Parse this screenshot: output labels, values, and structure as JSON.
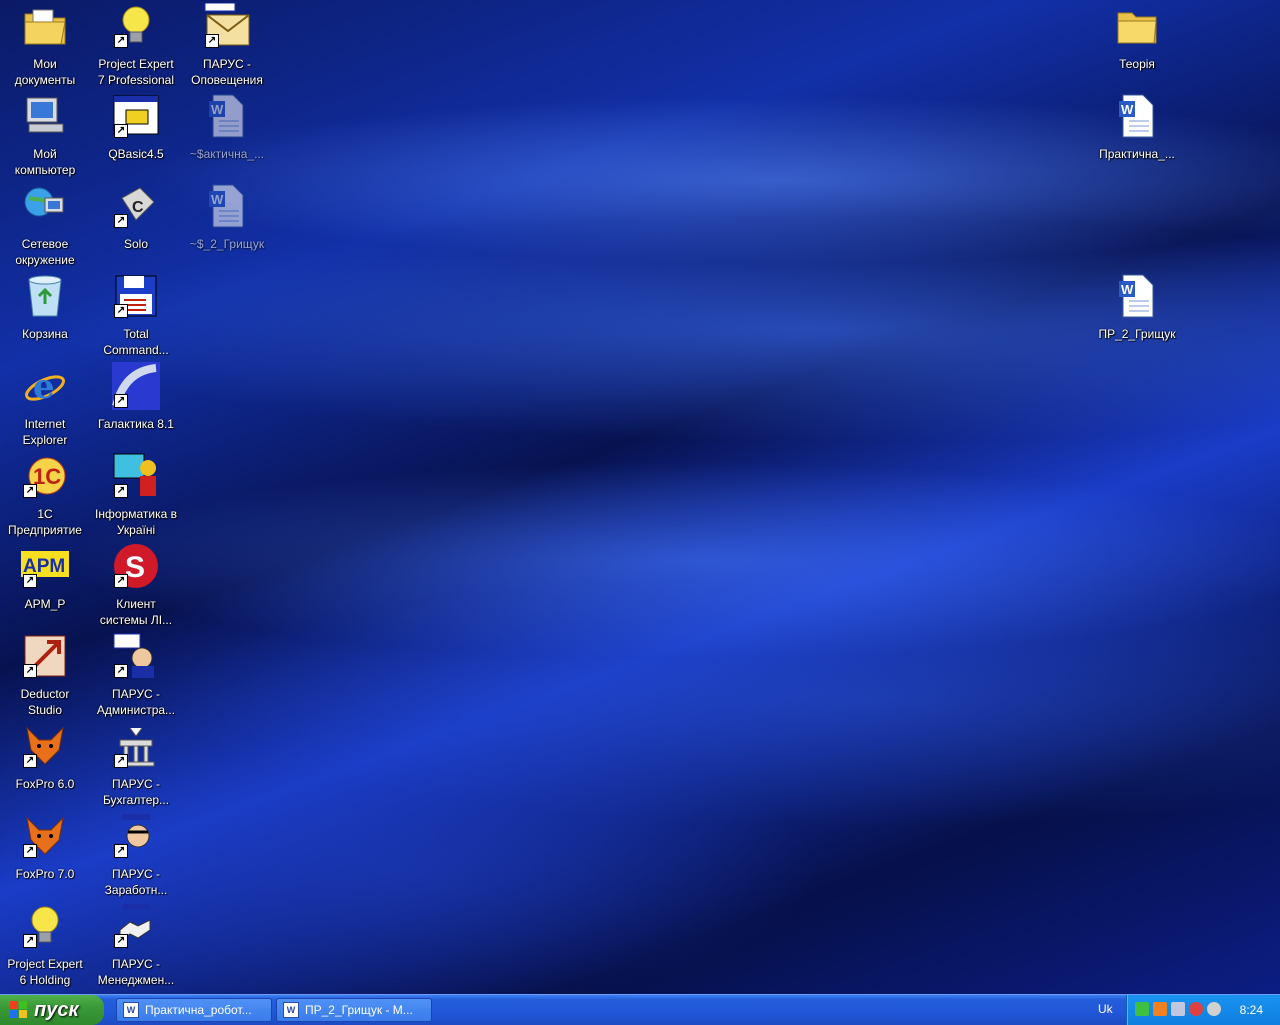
{
  "desktop": {
    "icons": [
      {
        "label": "Мои\nдокументы",
        "icon": "my-documents-icon"
      },
      {
        "label": "Project Expert\n7 Professional",
        "icon": "project-expert-icon"
      },
      {
        "label": "ПАРУС -\nОповещения",
        "icon": "parus-mail-icon"
      },
      {
        "label": "Мой\nкомпьютер",
        "icon": "my-computer-icon"
      },
      {
        "label": "QBasic4.5",
        "icon": "qbasic-icon"
      },
      {
        "label": "~$актична_...",
        "icon": "word-doc-icon"
      },
      {
        "label": "Сетевое\nокружение",
        "icon": "network-icon"
      },
      {
        "label": "Solo",
        "icon": "solo-icon"
      },
      {
        "label": "~$_2_Грищук",
        "icon": "word-doc-icon"
      },
      {
        "label": "Корзина",
        "icon": "recycle-bin-icon"
      },
      {
        "label": "Total\nCommand...",
        "icon": "total-commander-icon"
      },
      {
        "label": "Internet\nExplorer",
        "icon": "internet-explorer-icon"
      },
      {
        "label": "Галактика 8.1",
        "icon": "galaktika-icon"
      },
      {
        "label": "1С\nПредприятие",
        "icon": "1c-icon"
      },
      {
        "label": "Інформатика в\nУкраїні",
        "icon": "informatika-icon"
      },
      {
        "label": "APM_P",
        "icon": "apm-icon"
      },
      {
        "label": "Клиент\nсистемы ЛІ...",
        "icon": "client-system-icon"
      },
      {
        "label": "Deductor\nStudio",
        "icon": "deductor-icon"
      },
      {
        "label": "ПАРУС -\nАдминистра...",
        "icon": "parus-admin-icon"
      },
      {
        "label": "FoxPro 6.0",
        "icon": "foxpro-icon"
      },
      {
        "label": "ПАРУС -\nБухгалтер...",
        "icon": "parus-accounting-icon"
      },
      {
        "label": "FoxPro 7.0",
        "icon": "foxpro-icon"
      },
      {
        "label": "ПАРУС -\nЗаработн...",
        "icon": "parus-salary-icon"
      },
      {
        "label": "Project Expert\n6 Holding",
        "icon": "project-expert-icon"
      },
      {
        "label": "ПАРУС -\nМенеджмен...",
        "icon": "parus-management-icon"
      },
      {
        "label": "Теорія",
        "icon": "folder-icon"
      },
      {
        "label": "Практична_...",
        "icon": "word-doc-icon"
      },
      {
        "label": "ПР_2_Грищук",
        "icon": "word-doc-icon"
      }
    ]
  },
  "taskbar": {
    "start_label": "пуск",
    "tasks": [
      {
        "label": "Практична_робот..."
      },
      {
        "label": "ПР_2_Грищук - М..."
      }
    ],
    "language": "Uk",
    "clock": "8:24"
  },
  "colors": {
    "taskbar": "#245edb",
    "start": "#3a9a37",
    "tray": "#0f7fe0"
  }
}
